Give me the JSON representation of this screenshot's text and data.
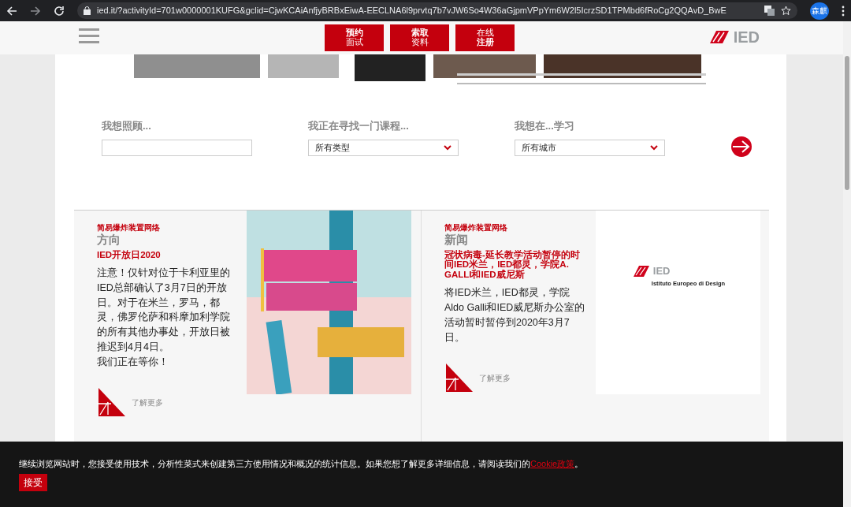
{
  "browser": {
    "url": "ied.it/?activityId=701w0000001KUFG&gclid=CjwKCAiAnfjyBRBxEiwA-EECLNA6l9prvtq7b7vJW6So4W36aGjpmVPpYm6W2l5IcrzSD1TPMbd6fRoCg2QQAvD_BwE",
    "profile": "森麒"
  },
  "header": {
    "buttons": [
      {
        "lines": [
          {
            "text": "预约",
            "bold": true
          },
          {
            "text": "面试",
            "bold": false
          }
        ]
      },
      {
        "lines": [
          {
            "text": "索取",
            "bold": true
          },
          {
            "text": "资料",
            "bold": false
          }
        ]
      },
      {
        "lines": [
          {
            "text": "在线",
            "bold": false
          },
          {
            "text": "注册",
            "bold": true
          }
        ]
      }
    ],
    "logo": "IED"
  },
  "hero": {
    "kind": "picture"
  },
  "search": {
    "fields": [
      {
        "kind": "text",
        "label": "我想照顾..."
      },
      {
        "kind": "select",
        "label": "我正在寻找一门课程...",
        "value": "所有类型"
      },
      {
        "kind": "select",
        "label": "我想在...学习",
        "value": "所有城市"
      }
    ]
  },
  "cards": [
    {
      "tag": "简易爆炸装置网络",
      "category": "方向",
      "title": "IED开放日2020",
      "body": [
        "注意！仅针对位于卡利亚里的IED总部确认了3月7日的开放日。对于在米兰，罗马，都灵，佛罗伦萨和科摩加利学院的所有其他办事处，开放日被推迟到4月4日。",
        "我们正在等你！"
      ],
      "link": "了解更多",
      "media": {
        "kind": "picture"
      }
    },
    {
      "tag": "简易爆炸装置网络",
      "category": "新闻",
      "title": "冠状病毒-延长教学活动暂停的时间IED米兰，IED都灵，学院A. GALLI和IED威尼斯",
      "body": [
        "将IED米兰，IED都灵，学院Aldo Galli和IED威尼斯办公室的活动暂时暂停到2020年3月7日。"
      ],
      "link": "了解更多",
      "media": {
        "kind": "logo",
        "name": "IED",
        "subtitle": "Istituto Europeo di Design"
      }
    }
  ],
  "cookie_banner": {
    "text": "继续浏览网站时，您接受使用技术，分析性菜式来创建第三方使用情况和概况的统计信息。如果您想了解更多详细信息，请阅读我们的",
    "link": "Cookie政策",
    "end": "。",
    "button": "接受"
  }
}
